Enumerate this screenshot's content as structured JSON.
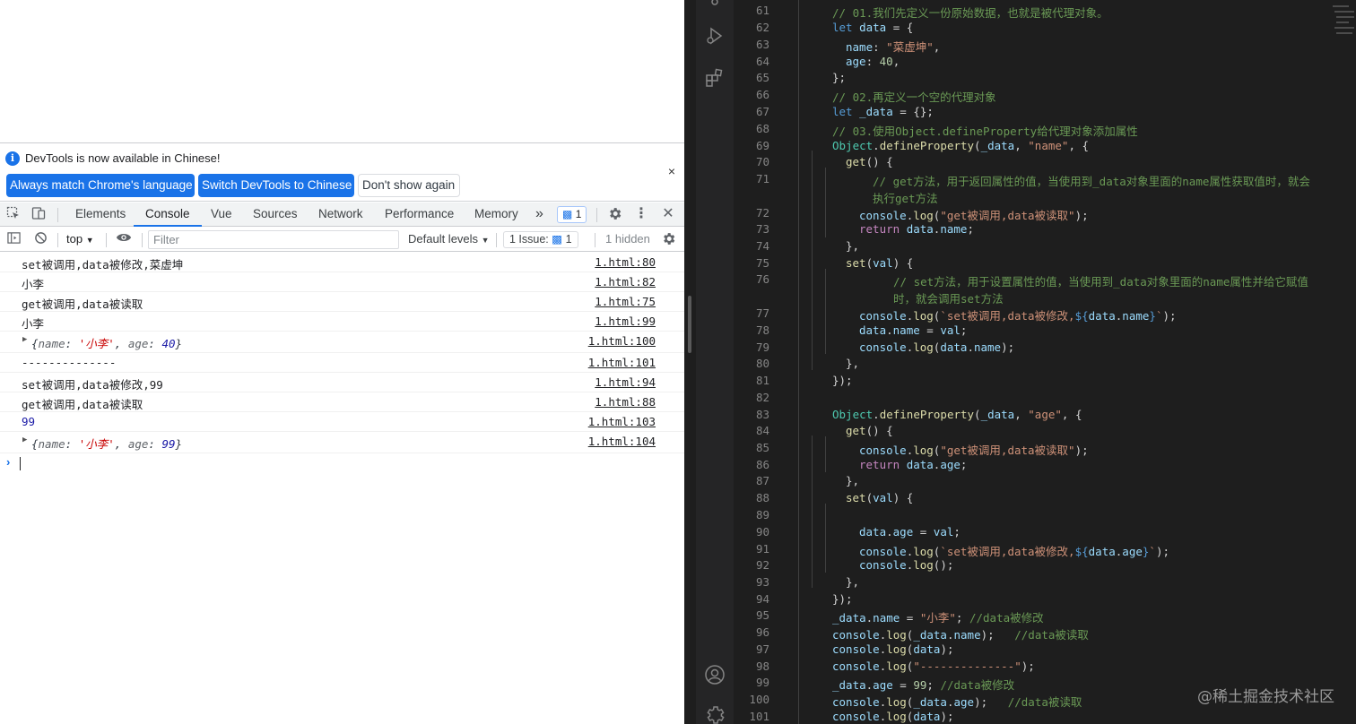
{
  "devtools": {
    "infobar": {
      "message": "DevTools is now available in Chinese!",
      "btn_match": "Always match Chrome's language",
      "btn_switch": "Switch DevTools to Chinese",
      "btn_dont_show": "Don't show again",
      "close": "×"
    },
    "tabs": [
      "Elements",
      "Console",
      "Vue",
      "Sources",
      "Network",
      "Performance",
      "Memory"
    ],
    "active_tab": "Console",
    "more": "»",
    "issues_badge": "1",
    "console_toolbar": {
      "context": "top",
      "filter_placeholder": "Filter",
      "levels": "Default levels",
      "issues": "1 Issue:",
      "issues_count": "1",
      "hidden": "1 hidden"
    },
    "logs": [
      {
        "msg": "set被调用,data被修改,菜虚坤",
        "src": "1.html:80"
      },
      {
        "msg": "小李",
        "src": "1.html:82"
      },
      {
        "msg": "get被调用,data被读取",
        "src": "1.html:75"
      },
      {
        "msg": "小李",
        "src": "1.html:99"
      },
      {
        "msg": "",
        "src": "1.html:100"
      },
      {
        "msg": "--------------",
        "src": "1.html:101"
      },
      {
        "msg": "set被调用,data被修改,99",
        "src": "1.html:94"
      },
      {
        "msg": "get被调用,data被读取",
        "src": "1.html:88"
      },
      {
        "msg": "99",
        "src": "1.html:103"
      },
      {
        "msg": "",
        "src": "1.html:104"
      }
    ],
    "obj1": {
      "k1": "name",
      "v1": "'小李'",
      "k2": "age",
      "v2": "40"
    },
    "obj2": {
      "k1": "name",
      "v1": "'小李'",
      "k2": "age",
      "v2": "99"
    }
  },
  "editor": {
    "line_numbers": [
      "61",
      "62",
      "63",
      "64",
      "65",
      "66",
      "67",
      "68",
      "69",
      "70",
      "71",
      "",
      "72",
      "73",
      "74",
      "75",
      "76",
      "",
      "77",
      "78",
      "79",
      "80",
      "81",
      "82",
      "83",
      "84",
      "85",
      "86",
      "87",
      "88",
      "89",
      "90",
      "91",
      "92",
      "93",
      "94",
      "95",
      "96",
      "97",
      "98",
      "99",
      "100",
      "101"
    ],
    "code": {
      "l61": "// 01.我们先定义一份原始数据，也就是被代理对象。",
      "l62_kw": "let",
      "l62_var": "data",
      "l62_rest": " = {",
      "l63_key": "name",
      "l63_str": "\"菜虚坤\"",
      "l64_key": "age",
      "l64_num": "40",
      "l65": "};",
      "l66": "// 02.再定义一个空的代理对象",
      "l67_kw": "let",
      "l67_var": "_data",
      "l67_rest": " = {};",
      "l68": "// 03.使用Object.defineProperty给代理对象添加属性",
      "l69_cls": "Object",
      "l69_fn": "defineProperty",
      "l69_var": "_data",
      "l69_str": "\"name\"",
      "l70_fn": "get",
      "l71a": "// get方法，用于返回属性的值，当使用到_data对象里面的name属性获取值时，就会",
      "l71b": "执行get方法",
      "l72_var": "console",
      "l72_fn": "log",
      "l72_str": "\"get被调用,data被读取\"",
      "l73_kw": "return",
      "l73_var": "data",
      "l73_var2": "name",
      "l74": "},",
      "l75_fn": "set",
      "l75_var": "val",
      "l76a": "// set方法，用于设置属性的值，当使用到_data对象里面的name属性并给它赋值",
      "l76b": "时，就会调用set方法",
      "l77_var": "console",
      "l77_fn": "log",
      "l77_str": "`set被调用,data被修改,",
      "l77_t": "${",
      "l77_var2": "data",
      "l77_var3": "name",
      "l77_t2": "}",
      "l77_end": "`",
      "l78_var": "data",
      "l78_var2": "name",
      "l78_var3": "val",
      "l79_var": "console",
      "l79_fn": "log",
      "l79_var2": "data",
      "l79_var3": "name",
      "l80": "},",
      "l81": "});",
      "l83_cls": "Object",
      "l83_fn": "defineProperty",
      "l83_var": "_data",
      "l83_str": "\"age\"",
      "l84_fn": "get",
      "l85_var": "console",
      "l85_fn": "log",
      "l85_str": "\"get被调用,data被读取\"",
      "l86_kw": "return",
      "l86_var": "data",
      "l86_var2": "age",
      "l87": "},",
      "l88_fn": "set",
      "l88_var": "val",
      "l90_var": "data",
      "l90_var2": "age",
      "l90_var3": "val",
      "l91_var": "console",
      "l91_fn": "log",
      "l91_str": "`set被调用,data被修改,",
      "l91_t": "${",
      "l91_var2": "data",
      "l91_var3": "age",
      "l91_t2": "}",
      "l91_end": "`",
      "l92_var": "console",
      "l92_fn": "log",
      "l93": "},",
      "l94": "});",
      "l95_var": "_data",
      "l95_var2": "name",
      "l95_str": "\"小李\"",
      "l95_cm": "//data被修改",
      "l96_var": "console",
      "l96_fn": "log",
      "l96_var2": "_data",
      "l96_var3": "name",
      "l96_cm": "//data被读取",
      "l97_var": "console",
      "l97_fn": "log",
      "l97_var2": "data",
      "l98_var": "console",
      "l98_fn": "log",
      "l98_str": "\"--------------\"",
      "l99_var": "_data",
      "l99_var2": "age",
      "l99_num": "99",
      "l99_cm": "//data被修改",
      "l100_var": "console",
      "l100_fn": "log",
      "l100_var2": "_data",
      "l100_var3": "age",
      "l100_cm": "//data被读取",
      "l101_var": "console",
      "l101_fn": "log",
      "l101_var2": "data"
    },
    "watermark": "@稀土掘金技术社区"
  }
}
